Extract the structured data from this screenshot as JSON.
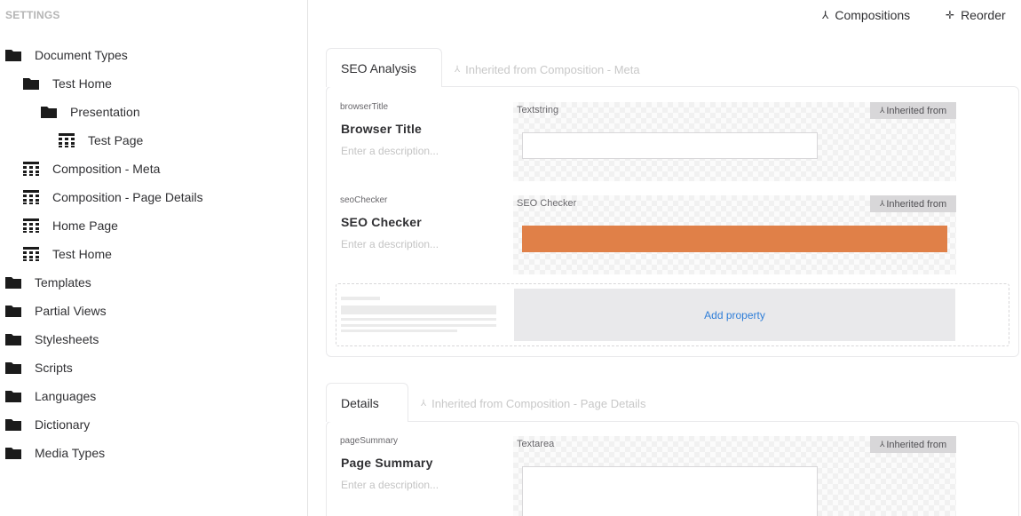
{
  "sidebar": {
    "header": "SETTINGS",
    "items": [
      {
        "label": "Document Types",
        "icon": "folder-icon"
      },
      {
        "label": "Test Home",
        "icon": "folder-icon"
      },
      {
        "label": "Presentation",
        "icon": "folder-icon"
      },
      {
        "label": "Test Page",
        "icon": "doctype-icon"
      },
      {
        "label": "Composition - Meta",
        "icon": "doctype-icon"
      },
      {
        "label": "Composition - Page Details",
        "icon": "doctype-icon"
      },
      {
        "label": "Home Page",
        "icon": "doctype-icon"
      },
      {
        "label": "Test Home",
        "icon": "doctype-icon"
      },
      {
        "label": "Templates",
        "icon": "folder-icon"
      },
      {
        "label": "Partial Views",
        "icon": "folder-icon"
      },
      {
        "label": "Stylesheets",
        "icon": "folder-icon"
      },
      {
        "label": "Scripts",
        "icon": "folder-icon"
      },
      {
        "label": "Languages",
        "icon": "folder-icon"
      },
      {
        "label": "Dictionary",
        "icon": "folder-icon"
      },
      {
        "label": "Media Types",
        "icon": "folder-icon"
      }
    ]
  },
  "toolbar": {
    "compositions_label": "Compositions",
    "reorder_label": "Reorder"
  },
  "groups": [
    {
      "tab_label": "SEO Analysis",
      "inherited_label": "Inherited from Composition - Meta",
      "properties": [
        {
          "alias": "browserTitle",
          "name": "Browser Title",
          "description": "Enter a description...",
          "editor": "Textstring",
          "badge": "Inherited from"
        },
        {
          "alias": "seoChecker",
          "name": "SEO Checker",
          "description": "Enter a description...",
          "editor": "SEO Checker",
          "badge": "Inherited from"
        }
      ],
      "add_property_label": "Add property"
    },
    {
      "tab_label": "Details",
      "inherited_label": "Inherited from Composition - Page Details",
      "properties": [
        {
          "alias": "pageSummary",
          "name": "Page Summary",
          "description": "Enter a description...",
          "editor": "Textarea",
          "badge": "Inherited from"
        }
      ]
    }
  ],
  "colors": {
    "seo_bar": "#e08048",
    "link": "#2f7ed8",
    "badge_bg": "#d8d7d9"
  }
}
